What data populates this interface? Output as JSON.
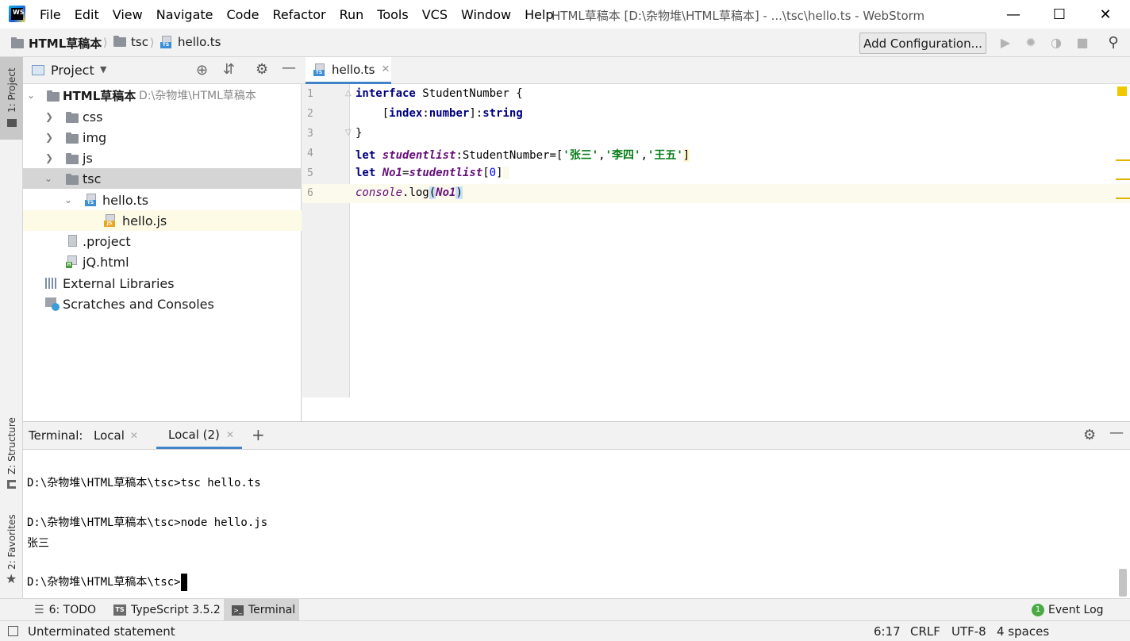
{
  "window": {
    "title": "HTML草稿本 [D:\\杂物堆\\HTML草稿本] - ...\\tsc\\hello.ts - WebStorm",
    "logo": "WS"
  },
  "menu": [
    "File",
    "Edit",
    "View",
    "Navigate",
    "Code",
    "Refactor",
    "Run",
    "Tools",
    "VCS",
    "Window",
    "Help"
  ],
  "breadcrumb": {
    "project": "HTML草稿本",
    "folder": "tsc",
    "file": "hello.ts"
  },
  "toolbar": {
    "add_config": "Add Configuration..."
  },
  "side_tabs": {
    "project": "1: Project",
    "structure": "Z: Structure",
    "favorites": "2: Favorites"
  },
  "project_panel": {
    "title": "Project",
    "tree": [
      {
        "label": "HTML草稿本",
        "path": "D:\\杂物堆\\HTML草稿本",
        "type": "root"
      },
      {
        "label": "css",
        "type": "folder"
      },
      {
        "label": "img",
        "type": "folder"
      },
      {
        "label": "js",
        "type": "folder"
      },
      {
        "label": "tsc",
        "type": "folder"
      },
      {
        "label": "hello.ts",
        "type": "ts"
      },
      {
        "label": "hello.js",
        "type": "js"
      },
      {
        "label": ".project",
        "type": "file"
      },
      {
        "label": "jQ.html",
        "type": "html"
      },
      {
        "label": "External Libraries",
        "type": "libs"
      },
      {
        "label": "Scratches and Consoles",
        "type": "scratch"
      }
    ]
  },
  "editor": {
    "tab": "hello.ts",
    "line_numbers": [
      "1",
      "2",
      "3",
      "4",
      "5",
      "6"
    ]
  },
  "terminal": {
    "label": "Terminal:",
    "tabs": [
      "Local",
      "Local (2)"
    ],
    "add": "+",
    "lines": [
      "D:\\杂物堆\\HTML草稿本\\tsc>tsc hello.ts",
      "D:\\杂物堆\\HTML草稿本\\tsc>node hello.js",
      "张三",
      "D:\\杂物堆\\HTML草稿本\\tsc>"
    ]
  },
  "bottom_tools": {
    "todo": "6: TODO",
    "typescript": "TypeScript 3.5.2",
    "terminal": "Terminal",
    "event_log": "Event Log"
  },
  "status": {
    "message": "Unterminated statement",
    "position": "6:17",
    "line_sep": "CRLF",
    "encoding": "UTF-8",
    "indent": "4 spaces"
  },
  "colors": {
    "accent": "#4083c9",
    "keyword": "#000080",
    "string": "#067d17",
    "italic": "#660e7a"
  }
}
